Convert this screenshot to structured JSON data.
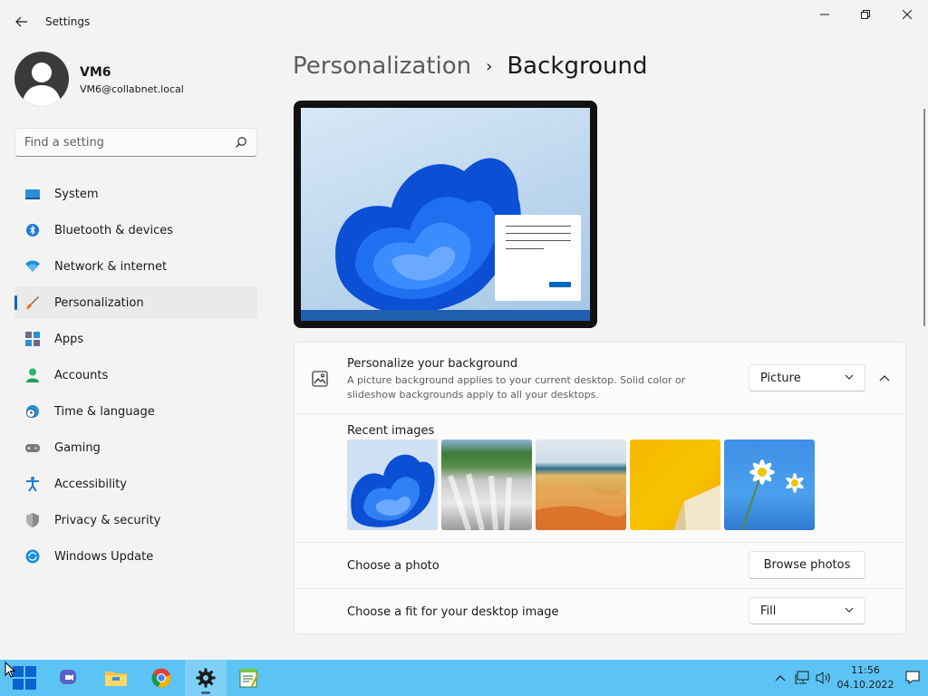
{
  "window": {
    "title": "Settings"
  },
  "profile": {
    "name": "VM6",
    "email": "VM6@collabnet.local"
  },
  "search": {
    "placeholder": "Find a setting"
  },
  "nav": {
    "items": [
      {
        "label": "System",
        "icon": "monitor-icon"
      },
      {
        "label": "Bluetooth & devices",
        "icon": "bluetooth-icon"
      },
      {
        "label": "Network & internet",
        "icon": "wifi-icon"
      },
      {
        "label": "Personalization",
        "icon": "brush-icon",
        "active": true
      },
      {
        "label": "Apps",
        "icon": "apps-icon"
      },
      {
        "label": "Accounts",
        "icon": "person-icon"
      },
      {
        "label": "Time & language",
        "icon": "globe-clock-icon"
      },
      {
        "label": "Gaming",
        "icon": "gamepad-icon"
      },
      {
        "label": "Accessibility",
        "icon": "accessibility-icon"
      },
      {
        "label": "Privacy & security",
        "icon": "shield-icon"
      },
      {
        "label": "Windows Update",
        "icon": "update-icon"
      }
    ]
  },
  "header": {
    "parent": "Personalization",
    "separator": "›",
    "current": "Background"
  },
  "background_setting": {
    "title": "Personalize your background",
    "description": "A picture background applies to your current desktop. Solid color or slideshow backgrounds apply to all your desktops.",
    "selected": "Picture"
  },
  "recent": {
    "label": "Recent images",
    "thumbnails": [
      "windows-bloom",
      "waterfall",
      "sand-dunes",
      "yellow-abstract",
      "daisies"
    ]
  },
  "photo": {
    "label": "Choose a photo",
    "button": "Browse photos"
  },
  "fit": {
    "label": "Choose a fit for your desktop image",
    "selected": "Fill"
  },
  "taskbar": {
    "time": "11:56",
    "date": "04.10.2022"
  },
  "colors": {
    "accent": "#0067c0",
    "taskbar": "#5cc4f5"
  }
}
